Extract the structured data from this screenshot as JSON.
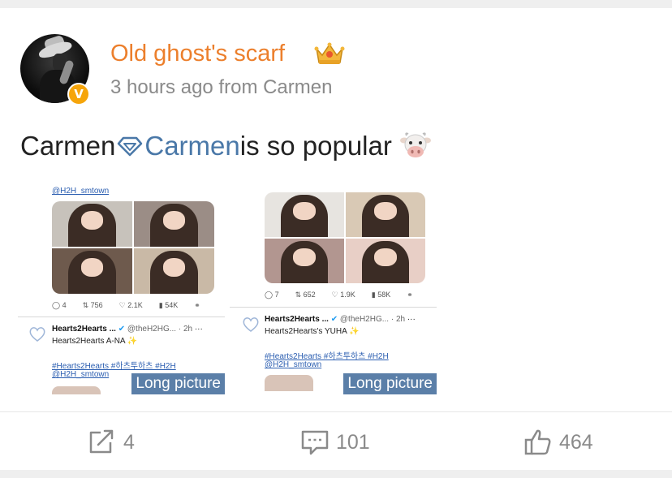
{
  "post": {
    "username": "Old ghost's scarf",
    "timestamp": "3 hours ago from Carmen",
    "text_before": "Carmen",
    "text_link": "Carmen",
    "text_after": " is so popular"
  },
  "avatar": {
    "badge_letter": "V",
    "badge_color": "#f6a50a"
  },
  "icons": {
    "crown": "crown-icon",
    "diamond": "diamond-icon",
    "cow": "cow-emoji-icon",
    "repost": "repost-icon",
    "comment": "comment-icon",
    "like": "thumbs-up-icon"
  },
  "images": [
    {
      "top_handle": "@H2H_smtown",
      "stats": {
        "replies": "4",
        "retweets": "756",
        "likes": "2.1K",
        "views": "54K"
      },
      "author": "Hearts2Hearts ...",
      "handle_time": "@theH2HG... · 2h",
      "tweet_text": "Hearts2Hearts A-NA ✨",
      "tags": "#Hearts2Hearts #하츠투하츠 #H2H",
      "handle": "@H2H_smtown",
      "badge": "Long picture"
    },
    {
      "top_handle": "",
      "stats": {
        "replies": "7",
        "retweets": "652",
        "likes": "1.9K",
        "views": "58K"
      },
      "author": "Hearts2Hearts ...",
      "handle_time": "@theH2HG... · 2h",
      "tweet_text": "Hearts2Hearts's YUHA ✨",
      "tags": "#Hearts2Hearts #하츠투하츠 #H2H",
      "handle": "@H2H_smtown",
      "badge": "Long picture"
    }
  ],
  "actions": {
    "repost_count": "4",
    "comment_count": "101",
    "like_count": "464"
  },
  "colors": {
    "username": "#ec7f2c",
    "link": "#4a78a8",
    "badge_bg": "#5b7fa8",
    "muted": "#8a8a8a"
  }
}
